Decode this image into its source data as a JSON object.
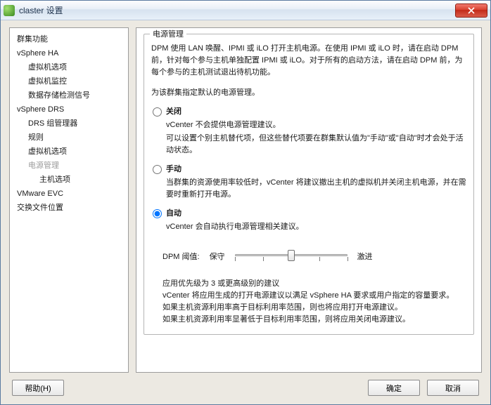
{
  "window": {
    "title": "claster 设置"
  },
  "sidebar": {
    "items": [
      {
        "label": "群集功能",
        "indent": 0
      },
      {
        "label": "vSphere HA",
        "indent": 0
      },
      {
        "label": "虚拟机选项",
        "indent": 1
      },
      {
        "label": "虚拟机监控",
        "indent": 1
      },
      {
        "label": "数据存储检测信号",
        "indent": 1
      },
      {
        "label": "vSphere DRS",
        "indent": 0
      },
      {
        "label": "DRS 组管理器",
        "indent": 1
      },
      {
        "label": "规则",
        "indent": 1
      },
      {
        "label": "虚拟机选项",
        "indent": 1
      },
      {
        "label": "电源管理",
        "indent": 1,
        "selected": true
      },
      {
        "label": "主机选项",
        "indent": 2
      },
      {
        "label": "VMware EVC",
        "indent": 0
      },
      {
        "label": "交换文件位置",
        "indent": 0
      }
    ]
  },
  "main": {
    "group_title": "电源管理",
    "intro": "DPM 使用 LAN 唤醒、IPMI 或 iLO 打开主机电源。在使用 IPMI 或 iLO 时，请在启动 DPM 前，针对每个参与主机单独配置 IPMI 或 iLO。对于所有的启动方法，请在启动 DPM 前，为每个参与的主机测试退出待机功能。",
    "subhead": "为该群集指定默认的电源管理。",
    "options": [
      {
        "value": "off",
        "title": "关闭",
        "text": "vCenter 不会提供电源管理建议。\n可以设置个别主机替代项，但这些替代项要在群集默认值为\"手动\"或\"自动\"时才会处于活动状态。"
      },
      {
        "value": "manual",
        "title": "手动",
        "text": "当群集的资源使用率较低时，vCenter 将建议撤出主机的虚拟机并关闭主机电源，并在需要时重新打开电源。"
      },
      {
        "value": "auto",
        "title": "自动",
        "text": "vCenter 会自动执行电源管理相关建议。"
      }
    ],
    "selected_option": "auto",
    "slider": {
      "label": "DPM 阈值:",
      "left": "保守",
      "right": "激进",
      "ticks": 5,
      "position": 3
    },
    "notes": "应用优先级为 3 或更高级别的建议\nvCenter 将应用生成的打开电源建议以满足 vSphere HA 要求或用户指定的容量要求。\n如果主机资源利用率高于目标利用率范围，则也将应用打开电源建议。\n如果主机资源利用率显著低于目标利用率范围，则将应用关闭电源建议。"
  },
  "buttons": {
    "help": "帮助(H)",
    "ok": "确定",
    "cancel": "取消"
  }
}
